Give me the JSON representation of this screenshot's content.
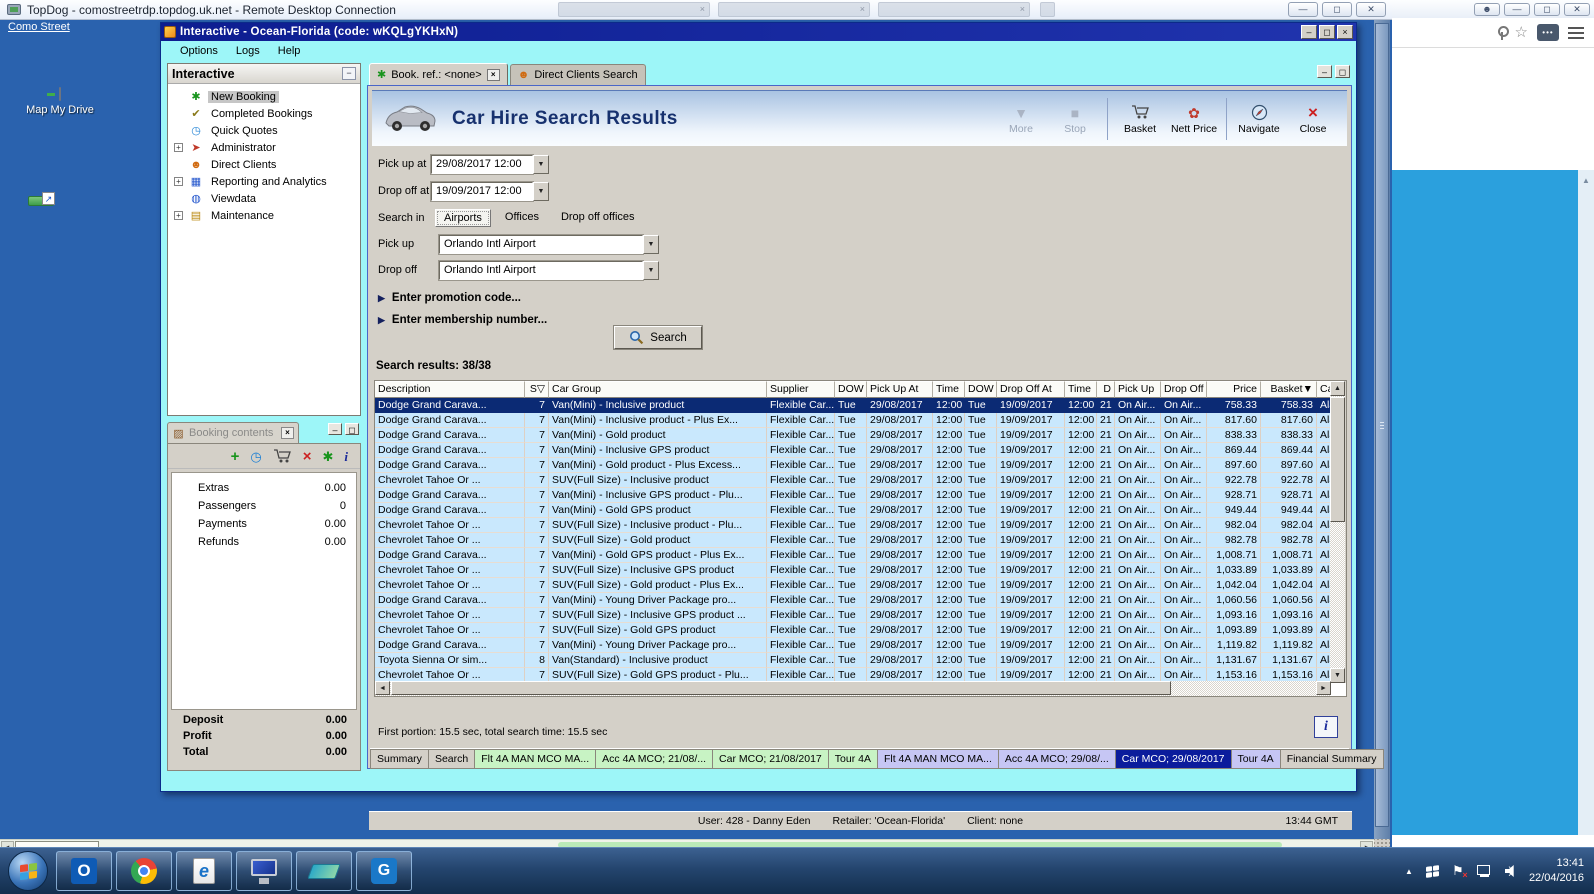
{
  "colors": {
    "desktop_blue": "#2a62ae",
    "app_cyan": "#9df6f8",
    "title_navy": "#0d1d90",
    "panel_grey": "#d4d0c8",
    "row_blue": "#c9e8fd",
    "selected_navy": "#0b2a74",
    "tab_green": "#c8f3c4",
    "tab_purple": "#c6c6f4",
    "tab_selected": "#0b1c9c",
    "right_page_blue": "#2ba0dd"
  },
  "rdp": {
    "title": "TopDog - comostreetrdp.topdog.uk.net - Remote Desktop Connection",
    "buttons": [
      "minimize-icon",
      "restore-icon",
      "close-icon"
    ]
  },
  "desktop": {
    "como_label": "Como Street",
    "map_drive_label": "Map My Drive"
  },
  "right_window": {
    "icons": [
      "profile-icon",
      "minimize-icon",
      "restore-icon",
      "close-icon",
      "key-icon",
      "star-icon",
      "more-badge-icon",
      "menu-icon"
    ],
    "scroll_arrow": "▲"
  },
  "app": {
    "title": "Interactive - Ocean-Florida (code: wKQLgYKHxN)",
    "window_buttons": [
      "minimize-icon",
      "maximize-icon",
      "close-icon"
    ],
    "menu": [
      "Options",
      "Logs",
      "Help"
    ],
    "tree": {
      "header": "Interactive",
      "collapse_glyph": "−",
      "items": [
        {
          "label": "New Booking",
          "icon": "palm-icon",
          "selected": true
        },
        {
          "label": "Completed Bookings",
          "icon": "bookings-icon"
        },
        {
          "label": "Quick Quotes",
          "icon": "clock-icon"
        },
        {
          "label": "Administrator",
          "icon": "runner-icon",
          "expandable": true
        },
        {
          "label": "Direct Clients",
          "icon": "person-icon"
        },
        {
          "label": "Reporting and Analytics",
          "icon": "report-icon",
          "expandable": true
        },
        {
          "label": "Viewdata",
          "icon": "globe-icon"
        },
        {
          "label": "Maintenance",
          "icon": "books-icon",
          "expandable": true
        }
      ]
    },
    "booking": {
      "title": "Booking contents",
      "toolbar": [
        "add-icon",
        "quick-quote-icon",
        "cart-icon",
        "delete-icon",
        "palm-icon",
        "info-icon"
      ],
      "rows": [
        {
          "label": "Extras",
          "value": "0.00"
        },
        {
          "label": "Passengers",
          "value": "0"
        },
        {
          "label": "Payments",
          "value": "0.00"
        },
        {
          "label": "Refunds",
          "value": "0.00"
        }
      ],
      "totals": [
        {
          "label": "Deposit",
          "value": "0.00"
        },
        {
          "label": "Profit",
          "value": "0.00"
        },
        {
          "label": "Total",
          "value": "0.00"
        }
      ]
    },
    "doc_tabs": [
      {
        "label": "Book. ref.: <none>",
        "icon": "palm-icon",
        "active": true,
        "closable": true
      },
      {
        "label": "Direct Clients Search",
        "icon": "person-icon",
        "active": false,
        "closable": false
      }
    ],
    "page": {
      "title": "Car Hire Search Results",
      "toolbar": [
        {
          "label": "More",
          "icon": "caret-down-icon",
          "disabled": true
        },
        {
          "label": "Stop",
          "icon": "stop-icon",
          "disabled": true
        },
        {
          "label": "Basket",
          "icon": "cart-icon",
          "disabled": false
        },
        {
          "label": "Nett Price",
          "icon": "price-icon",
          "disabled": false
        },
        {
          "label": "Navigate",
          "icon": "compass-icon",
          "disabled": false
        },
        {
          "label": "Close",
          "icon": "close-icon",
          "disabled": false
        }
      ],
      "form": {
        "pick_up_at": {
          "label": "Pick up at",
          "value": "29/08/2017 12:00"
        },
        "drop_off_at": {
          "label": "Drop off at",
          "value": "19/09/2017 12:00"
        },
        "search_in": {
          "label": "Search in",
          "options": [
            "Airports",
            "Offices",
            "Drop off offices"
          ],
          "selected": "Airports"
        },
        "pick_up": {
          "label": "Pick up",
          "value": "Orlando Intl Airport"
        },
        "drop_off": {
          "label": "Drop off",
          "value": "Orlando Intl Airport"
        }
      },
      "promo_toggle": "Enter promotion code...",
      "membership_toggle": "Enter membership number...",
      "search_button_label": "Search",
      "results_label": "Search results: 38/38",
      "timing": "First portion: 15.5 sec, total search time: 15.5 sec",
      "info_button": "i",
      "bottom_tabs": [
        {
          "label": "Summary",
          "color": "plain"
        },
        {
          "label": "Search",
          "color": "plain"
        },
        {
          "label": "Flt 4A MAN MCO MA...",
          "color": "green"
        },
        {
          "label": "Acc 4A MCO; 21/08/...",
          "color": "green"
        },
        {
          "label": "Car MCO; 21/08/2017",
          "color": "green"
        },
        {
          "label": "Tour 4A",
          "color": "green"
        },
        {
          "label": "Flt 4A MAN MCO MA...",
          "color": "purple"
        },
        {
          "label": "Acc 4A MCO; 29/08/...",
          "color": "purple"
        },
        {
          "label": "Car MCO; 29/08/2017",
          "color": "selected"
        },
        {
          "label": "Tour 4A",
          "color": "purple"
        },
        {
          "label": "Financial Summary",
          "color": "plain"
        }
      ]
    },
    "status": {
      "user": "User: 428 - Danny Eden",
      "retailer": "Retailer: 'Ocean-Florida'",
      "client": "Client: none",
      "time": "13:44 GMT"
    },
    "table": {
      "columns": [
        "Description",
        "S",
        "Car Group",
        "Supplier",
        "DOW",
        "Pick Up At",
        "Time",
        "DOW",
        "Drop Off At",
        "Time",
        "D",
        "Pick Up",
        "Drop Off",
        "Price",
        "Basket",
        "Ca"
      ],
      "shared": {
        "supplier": "Flexible Car...",
        "dow_pick": "Tue",
        "pick_up_at": "29/08/2017",
        "pick_time": "12:00",
        "dow_drop": "Tue",
        "drop_off_at": "19/09/2017",
        "drop_time": "12:00",
        "days": "21",
        "pick_up_loc": "On Air...",
        "drop_off_loc": "On Air...",
        "last_col": "Ala"
      },
      "rows": [
        {
          "description": "Dodge Grand Carava...",
          "seats": "7",
          "car_group": "Van(Mini) - Inclusive product",
          "price": "758.33",
          "basket": "758.33",
          "selected": true
        },
        {
          "description": "Dodge Grand Carava...",
          "seats": "7",
          "car_group": "Van(Mini) - Inclusive product - Plus Ex...",
          "price": "817.60",
          "basket": "817.60"
        },
        {
          "description": "Dodge Grand Carava...",
          "seats": "7",
          "car_group": "Van(Mini) - Gold product",
          "price": "838.33",
          "basket": "838.33"
        },
        {
          "description": "Dodge Grand Carava...",
          "seats": "7",
          "car_group": "Van(Mini) - Inclusive GPS product",
          "price": "869.44",
          "basket": "869.44"
        },
        {
          "description": "Dodge Grand Carava...",
          "seats": "7",
          "car_group": "Van(Mini) - Gold product - Plus Excess...",
          "price": "897.60",
          "basket": "897.60"
        },
        {
          "description": "Chevrolet Tahoe Or ...",
          "seats": "7",
          "car_group": "SUV(Full Size) - Inclusive product",
          "price": "922.78",
          "basket": "922.78"
        },
        {
          "description": "Dodge Grand Carava...",
          "seats": "7",
          "car_group": "Van(Mini) - Inclusive GPS product - Plu...",
          "price": "928.71",
          "basket": "928.71"
        },
        {
          "description": "Dodge Grand Carava...",
          "seats": "7",
          "car_group": "Van(Mini) - Gold GPS product",
          "price": "949.44",
          "basket": "949.44"
        },
        {
          "description": "Chevrolet Tahoe Or ...",
          "seats": "7",
          "car_group": "SUV(Full Size) - Inclusive product - Plu...",
          "price": "982.04",
          "basket": "982.04"
        },
        {
          "description": "Chevrolet Tahoe Or ...",
          "seats": "7",
          "car_group": "SUV(Full Size) - Gold product",
          "price": "982.78",
          "basket": "982.78"
        },
        {
          "description": "Dodge Grand Carava...",
          "seats": "7",
          "car_group": "Van(Mini) - Gold GPS product - Plus Ex...",
          "price": "1,008.71",
          "basket": "1,008.71"
        },
        {
          "description": "Chevrolet Tahoe Or ...",
          "seats": "7",
          "car_group": "SUV(Full Size) - Inclusive GPS product",
          "price": "1,033.89",
          "basket": "1,033.89"
        },
        {
          "description": "Chevrolet Tahoe Or ...",
          "seats": "7",
          "car_group": "SUV(Full Size) - Gold product - Plus Ex...",
          "price": "1,042.04",
          "basket": "1,042.04"
        },
        {
          "description": "Dodge Grand Carava...",
          "seats": "7",
          "car_group": "Van(Mini) - Young Driver Package pro...",
          "price": "1,060.56",
          "basket": "1,060.56"
        },
        {
          "description": "Chevrolet Tahoe Or ...",
          "seats": "7",
          "car_group": "SUV(Full Size) - Inclusive GPS product ...",
          "price": "1,093.16",
          "basket": "1,093.16"
        },
        {
          "description": "Chevrolet Tahoe Or ...",
          "seats": "7",
          "car_group": "SUV(Full Size) - Gold GPS product",
          "price": "1,093.89",
          "basket": "1,093.89"
        },
        {
          "description": "Dodge Grand Carava...",
          "seats": "7",
          "car_group": "Van(Mini) - Young Driver Package pro...",
          "price": "1,119.82",
          "basket": "1,119.82"
        },
        {
          "description": "Toyota Sienna Or sim...",
          "seats": "8",
          "car_group": "Van(Standard) - Inclusive product",
          "price": "1,131.67",
          "basket": "1,131.67"
        },
        {
          "description": "Chevrolet Tahoe Or ...",
          "seats": "7",
          "car_group": "SUV(Full Size) - Gold GPS product - Plu...",
          "price": "1,153.16",
          "basket": "1,153.16"
        }
      ]
    }
  },
  "taskbar": {
    "apps": [
      "outlook",
      "chrome",
      "ie",
      "rdp",
      "maps",
      "g"
    ],
    "time": "13:41",
    "date": "22/04/2016"
  }
}
